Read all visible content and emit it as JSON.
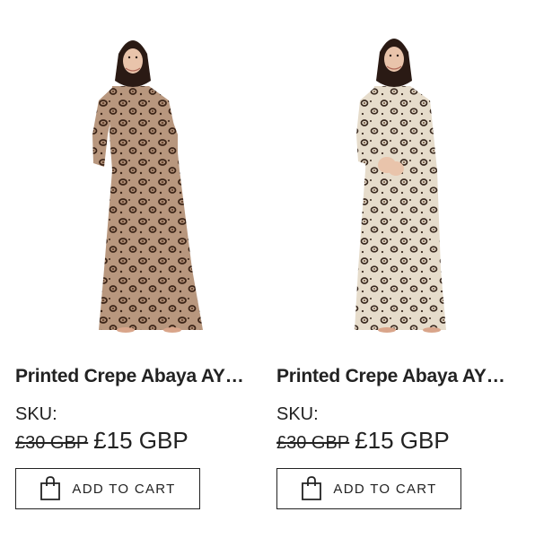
{
  "products": [
    {
      "title": "Printed Crepe Abaya AYP-...",
      "sku_label": "SKU:",
      "old_price": "£30 GBP",
      "new_price": "£15 GBP",
      "cart_label": "ADD TO CART",
      "cart_icon": "shopping-bag-icon",
      "image": "abaya-brown-leopard",
      "fabric_color": "#b8977e",
      "spot_color": "#3b2417",
      "hijab_color": "#2a1a14"
    },
    {
      "title": "Printed Crepe Abaya AYP-...",
      "sku_label": "SKU:",
      "old_price": "£30 GBP",
      "new_price": "£15 GBP",
      "cart_label": "ADD TO CART",
      "cart_icon": "shopping-bag-icon",
      "image": "abaya-cream-leopard",
      "fabric_color": "#e6dccb",
      "spot_color": "#3a2a20",
      "hijab_color": "#2a1a14"
    }
  ]
}
